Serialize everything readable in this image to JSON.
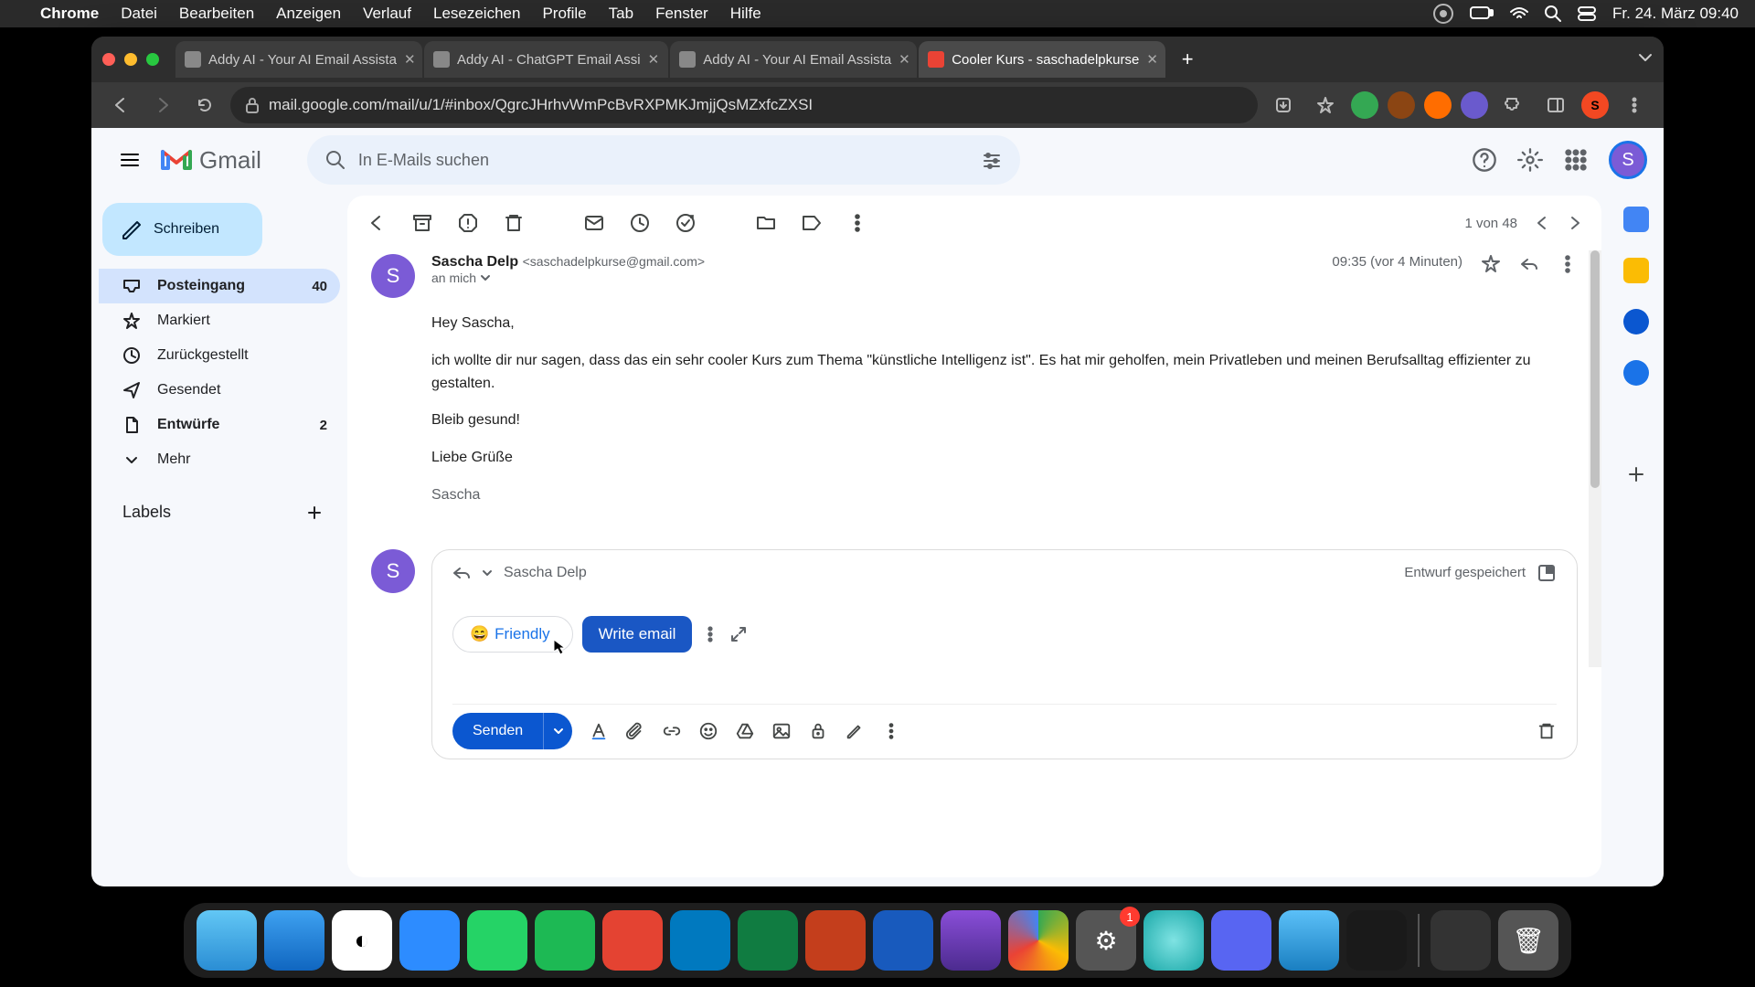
{
  "menubar": {
    "app": "Chrome",
    "menus": [
      "Datei",
      "Bearbeiten",
      "Anzeigen",
      "Verlauf",
      "Lesezeichen",
      "Profile",
      "Tab",
      "Fenster",
      "Hilfe"
    ],
    "clock": "Fr. 24. März  09:40"
  },
  "tabs": [
    {
      "label": "Addy AI - Your AI Email Assista"
    },
    {
      "label": "Addy AI - ChatGPT Email Assi"
    },
    {
      "label": "Addy AI - Your AI Email Assista"
    },
    {
      "label": "Cooler Kurs - saschadelpkurse",
      "active": true
    }
  ],
  "url": "mail.google.com/mail/u/1/#inbox/QgrcJHrhvWmPcBvRXPMKJmjjQsMZxfcZXSI",
  "gmail": {
    "brand": "Gmail",
    "search_placeholder": "In E-Mails suchen",
    "compose": "Schreiben",
    "nav": [
      {
        "label": "Posteingang",
        "count": "40",
        "sel": true,
        "icon": "inbox"
      },
      {
        "label": "Markiert",
        "icon": "star"
      },
      {
        "label": "Zurückgestellt",
        "icon": "clock"
      },
      {
        "label": "Gesendet",
        "icon": "send"
      },
      {
        "label": "Entwürfe",
        "count": "2",
        "icon": "file",
        "bold": true
      },
      {
        "label": "Mehr",
        "icon": "chev"
      }
    ],
    "labels_hdr": "Labels"
  },
  "pager": "1 von 48",
  "sender": {
    "name": "Sascha Delp",
    "email": "<saschadelpkurse@gmail.com>",
    "to": "an mich",
    "avatar": "S"
  },
  "timestamp": "09:35 (vor 4 Minuten)",
  "body": {
    "l1": "Hey Sascha,",
    "l2": "ich wollte dir nur sagen, dass das ein sehr cooler Kurs zum Thema \"künstliche Intelligenz ist\". Es hat mir geholfen, mein Privatleben und meinen Berufsalltag effizienter zu gestalten.",
    "l3": "Bleib gesund!",
    "l4": "Liebe Grüße",
    "l5": "Sascha"
  },
  "reply": {
    "to": "Sascha Delp",
    "draft_status": "Entwurf gespeichert",
    "chip_friendly": "Friendly",
    "chip_write": "Write email",
    "send": "Senden"
  },
  "dock": {
    "badge_systemsettings": "1"
  }
}
